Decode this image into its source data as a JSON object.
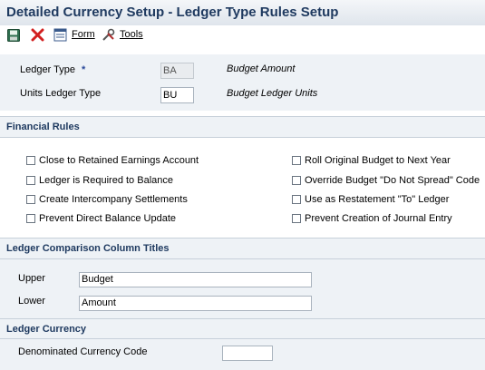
{
  "window": {
    "title": "Detailed Currency Setup - Ledger Type Rules Setup"
  },
  "toolbar": {
    "save_icon": "save-icon",
    "cancel_icon": "close-icon",
    "form_label": "Form",
    "tools_label": "Tools"
  },
  "header": {
    "ledger_type_label": "Ledger Type",
    "ledger_type_required": "*",
    "ledger_type_value": "BA",
    "ledger_type_desc": "Budget Amount",
    "units_ledger_type_label": "Units Ledger Type",
    "units_ledger_type_value": "BU",
    "units_ledger_type_desc": "Budget Ledger Units"
  },
  "financial_rules": {
    "title": "Financial Rules",
    "left": [
      {
        "label": "Close to Retained Earnings Account",
        "checked": false
      },
      {
        "label": "Ledger is Required to Balance",
        "checked": false
      },
      {
        "label": "Create Intercompany Settlements",
        "checked": false
      },
      {
        "label": "Prevent Direct Balance Update",
        "checked": false
      }
    ],
    "right": [
      {
        "label": "Roll Original Budget to Next Year",
        "checked": false
      },
      {
        "label": "Override Budget \"Do Not Spread\" Code",
        "checked": false
      },
      {
        "label": "Use as Restatement \"To\" Ledger",
        "checked": false
      },
      {
        "label": "Prevent Creation of Journal Entry",
        "checked": false
      }
    ]
  },
  "comparison": {
    "title": "Ledger Comparison Column Titles",
    "upper_label": "Upper",
    "upper_value": "Budget",
    "lower_label": "Lower",
    "lower_value": "Amount"
  },
  "currency": {
    "title": "Ledger Currency",
    "denominated_label": "Denominated Currency Code",
    "denominated_value": ""
  }
}
